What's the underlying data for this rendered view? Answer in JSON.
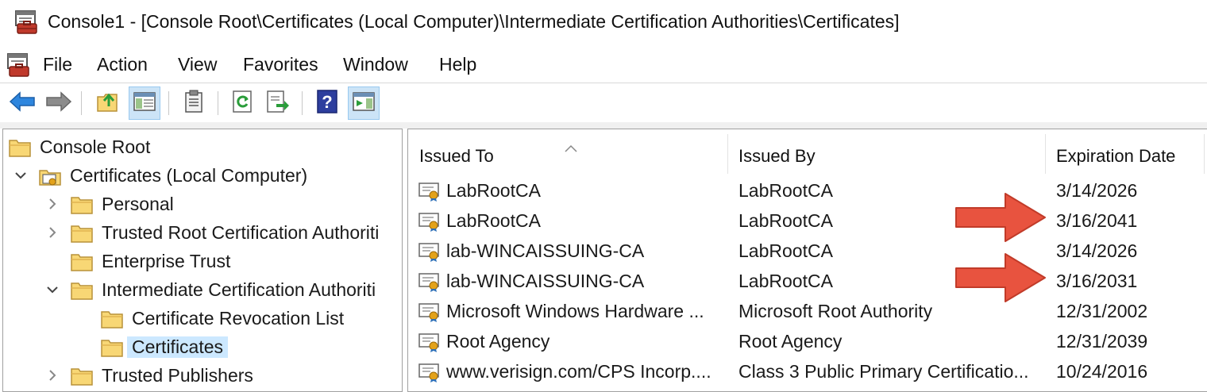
{
  "window": {
    "title": "Console1 - [Console Root\\Certificates (Local Computer)\\Intermediate Certification Authorities\\Certificates]"
  },
  "menu": {
    "items": [
      "File",
      "Action",
      "View",
      "Favorites",
      "Window",
      "Help"
    ]
  },
  "toolbar": {
    "buttons": [
      "back-icon",
      "forward-icon",
      "up-folder-icon",
      "show-hide-tree-icon",
      "export-list-icon",
      "refresh-icon",
      "export-icon",
      "help-icon",
      "show-hide-action-pane-icon"
    ]
  },
  "tree": {
    "nodes": [
      {
        "label": "Console Root",
        "level": 0,
        "expander": "none"
      },
      {
        "label": "Certificates (Local Computer)",
        "level": 1,
        "expander": "expanded"
      },
      {
        "label": "Personal",
        "level": 2,
        "expander": "collapsed"
      },
      {
        "label": "Trusted Root Certification Authoriti",
        "level": 2,
        "expander": "collapsed"
      },
      {
        "label": "Enterprise Trust",
        "level": 2,
        "expander": "none"
      },
      {
        "label": "Intermediate Certification Authoriti",
        "level": 2,
        "expander": "expanded"
      },
      {
        "label": "Certificate Revocation List",
        "level": 3,
        "expander": "none"
      },
      {
        "label": "Certificates",
        "level": 3,
        "expander": "none",
        "selected": true
      },
      {
        "label": "Trusted Publishers",
        "level": 2,
        "expander": "collapsed"
      }
    ]
  },
  "list": {
    "columns": [
      "Issued To",
      "Issued By",
      "Expiration Date"
    ],
    "rows": [
      {
        "issued_to": "LabRootCA",
        "issued_by": "LabRootCA",
        "expiration": "3/14/2026"
      },
      {
        "issued_to": "LabRootCA",
        "issued_by": "LabRootCA",
        "expiration": "3/16/2041",
        "highlighted": true
      },
      {
        "issued_to": "lab-WINCAISSUING-CA",
        "issued_by": "LabRootCA",
        "expiration": "3/14/2026"
      },
      {
        "issued_to": "lab-WINCAISSUING-CA",
        "issued_by": "LabRootCA",
        "expiration": "3/16/2031",
        "highlighted": true
      },
      {
        "issued_to": "Microsoft Windows Hardware ...",
        "issued_by": "Microsoft Root Authority",
        "expiration": "12/31/2002"
      },
      {
        "issued_to": "Root Agency",
        "issued_by": "Root Agency",
        "expiration": "12/31/2039"
      },
      {
        "issued_to": "www.verisign.com/CPS Incorp....",
        "issued_by": "Class 3 Public Primary Certificatio...",
        "expiration": "10/24/2016"
      }
    ]
  },
  "colors": {
    "annotation_arrow": "#e8533f",
    "selection": "#cce8ff",
    "pressed_button": "#cce4f7",
    "folder": "#f8d775"
  }
}
